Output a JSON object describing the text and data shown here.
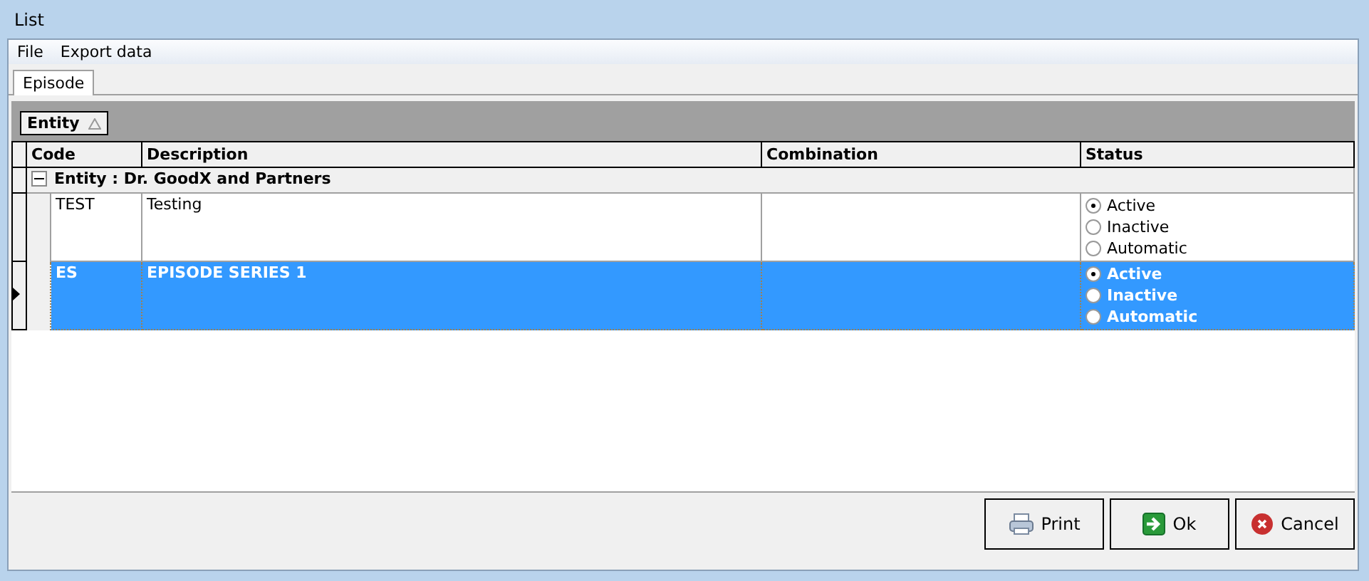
{
  "window": {
    "title": "List"
  },
  "menu": [
    "File",
    "Export data"
  ],
  "tabs": [
    {
      "label": "Episode",
      "selected": true
    }
  ],
  "group_by": {
    "label": "Entity"
  },
  "table": {
    "columns": [
      "Code",
      "Description",
      "Combination",
      "Status"
    ],
    "group": {
      "label": "Entity : Dr. GoodX and Partners",
      "expanded": true
    },
    "rows": [
      {
        "selected": false,
        "code": "TEST",
        "description": "Testing",
        "status": [
          {
            "label": "Active",
            "selected": true
          },
          {
            "label": "Inactive",
            "selected": false
          },
          {
            "label": "Automatic",
            "selected": false
          }
        ]
      },
      {
        "selected": true,
        "code": "ES",
        "description": "EPISODE SERIES 1",
        "status": [
          {
            "label": "Active",
            "selected": true
          },
          {
            "label": "Inactive",
            "selected": false
          },
          {
            "label": "Automatic",
            "selected": false
          }
        ]
      }
    ]
  },
  "buttons": [
    {
      "kind": "print",
      "label": "Print"
    },
    {
      "kind": "ok",
      "label": "Ok"
    },
    {
      "kind": "cancel",
      "label": "Cancel"
    }
  ]
}
